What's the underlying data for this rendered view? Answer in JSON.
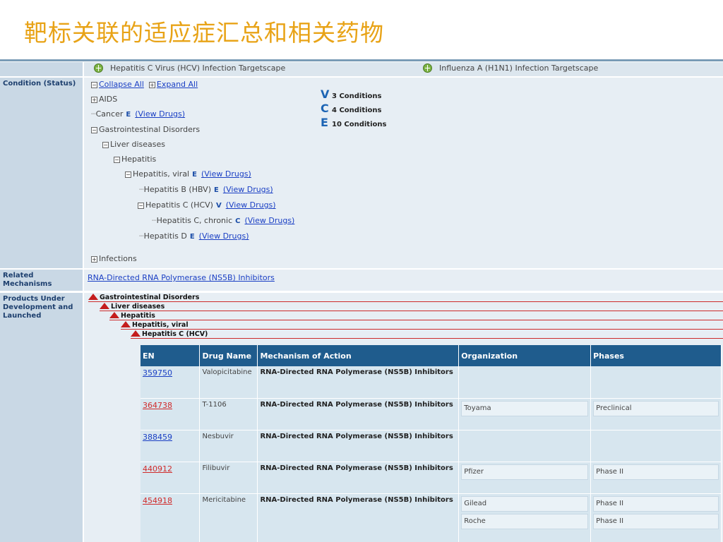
{
  "slide": {
    "title": "靶标关联的适应症汇总和相关药物"
  },
  "targetscapes": [
    {
      "label": "Hepatitis C Virus (HCV) Infection Targetscape"
    },
    {
      "label": "Influenza A (H1N1) Infection Targetscape"
    }
  ],
  "condition": {
    "label": "Condition (Status)",
    "collapse_all": "Collapse All",
    "expand_all": "Expand All",
    "view_drugs": "(View Drugs)",
    "legend": [
      {
        "letter": "V",
        "text": "3 Conditions"
      },
      {
        "letter": "C",
        "text": "4 Conditions"
      },
      {
        "letter": "E",
        "text": "10 Conditions"
      }
    ],
    "tree": {
      "aids": "AIDS",
      "cancer": "Cancer",
      "cancer_status": "E",
      "gi": "Gastrointestinal Disorders",
      "liver": "Liver diseases",
      "hepatitis": "Hepatitis",
      "hep_viral": "Hepatitis, viral",
      "hep_viral_status": "E",
      "hep_b": "Hepatitis B (HBV)",
      "hep_b_status": "E",
      "hep_c": "Hepatitis C (HCV)",
      "hep_c_status": "V",
      "hep_c_chronic": "Hepatitis C, chronic",
      "hep_c_chronic_status": "C",
      "hep_d": "Hepatitis D",
      "hep_d_status": "E",
      "infections": "Infections"
    }
  },
  "mechanisms": {
    "label": "Related Mechanisms",
    "link": "RNA-Directed RNA Polymerase (NS5B) Inhibitors"
  },
  "products": {
    "label": "Products Under Development and Launched",
    "hierarchy": [
      "Gastrointestinal Disorders",
      "Liver diseases",
      "Hepatitis",
      "Hepatitis, viral",
      "Hepatitis C (HCV)"
    ],
    "columns": [
      "EN",
      "Drug Name",
      "Mechanism of Action",
      "Organization",
      "Phases"
    ],
    "rows": [
      {
        "en": "359750",
        "drug": "Valopicitabine",
        "mechanism": "RNA-Directed RNA Polymerase (NS5B) Inhibitors",
        "orgs": [],
        "link_color": "blue"
      },
      {
        "en": "364738",
        "drug": "T-1106",
        "mechanism": "RNA-Directed RNA Polymerase (NS5B) Inhibitors",
        "orgs": [
          {
            "org": "Toyama",
            "phase": "Preclinical"
          }
        ],
        "link_color": "red"
      },
      {
        "en": "388459",
        "drug": "Nesbuvir",
        "mechanism": "RNA-Directed RNA Polymerase (NS5B) Inhibitors",
        "orgs": [],
        "link_color": "blue"
      },
      {
        "en": "440912",
        "drug": "Filibuvir",
        "mechanism": "RNA-Directed RNA Polymerase (NS5B) Inhibitors",
        "orgs": [
          {
            "org": "Pfizer",
            "phase": "Phase II"
          }
        ],
        "link_color": "red"
      },
      {
        "en": "454918",
        "drug": "Mericitabine",
        "mechanism": "RNA-Directed RNA Polymerase (NS5B) Inhibitors",
        "orgs": [
          {
            "org": "Gilead",
            "phase": "Phase II"
          },
          {
            "org": "Roche",
            "phase": "Phase II"
          }
        ],
        "link_color": "red"
      }
    ]
  },
  "colors": {
    "title": "#e8a317",
    "header_blue": "#1f5c8d",
    "link_blue": "#1a3fc4",
    "link_red": "#d02b2b",
    "triangle_red": "#c41d1d"
  }
}
